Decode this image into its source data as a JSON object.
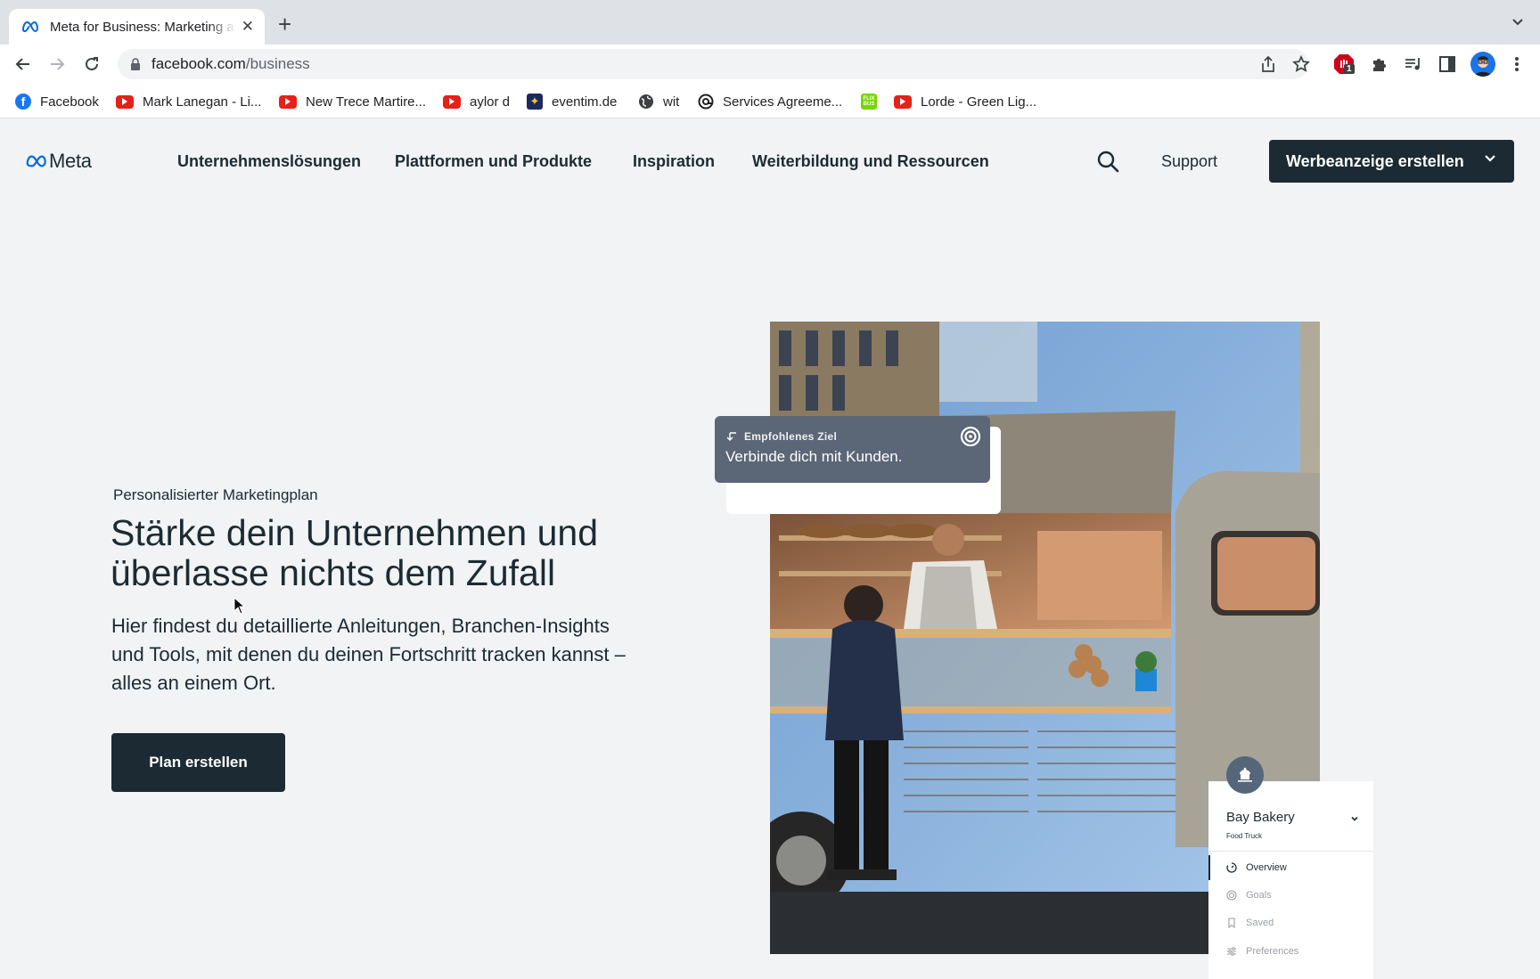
{
  "browser": {
    "tab": {
      "title": "Meta for Business: Marketing and Advertising",
      "favicon": "meta-logo-icon"
    },
    "new_tab_label": "+",
    "url": {
      "domain": "facebook.com",
      "path": "/business"
    },
    "extensions": {
      "adblock_badge": "1"
    },
    "bookmarks": [
      {
        "label": "Facebook",
        "icon": "facebook-icon"
      },
      {
        "label": "Mark Lanegan - Li...",
        "icon": "youtube-icon"
      },
      {
        "label": "New Trece Martire...",
        "icon": "youtube-icon"
      },
      {
        "label": "aylor d",
        "icon": "youtube-icon"
      },
      {
        "label": "eventim.de",
        "icon": "eventim-icon"
      },
      {
        "label": "wit",
        "icon": "globe-icon"
      },
      {
        "label": "Services Agreeme...",
        "icon": "at-sign-icon"
      },
      {
        "label": "",
        "icon": "flixbus-icon"
      },
      {
        "label": "Lorde - Green Lig...",
        "icon": "youtube-icon"
      }
    ]
  },
  "header": {
    "logo_text": "Meta",
    "nav": [
      "Unternehmenslösungen",
      "Plattformen und Produkte",
      "Inspiration",
      "Weiterbildung und Ressourcen"
    ],
    "support_label": "Support",
    "cta_label": "Werbeanzeige erstellen"
  },
  "hero": {
    "eyebrow": "Personalisierter Marketingplan",
    "headline": "Stärke dein Unternehmen und überlasse nichts dem Zufall",
    "body": "Hier findest du detaillierte Anleitungen, Branchen-Insights und Tools, mit denen du deinen Fortschritt tracken kannst – alles an einem Ort.",
    "button_label": "Plan erstellen"
  },
  "goal_card": {
    "label": "Empfohlenes Ziel",
    "value": "Verbinde dich mit Kunden."
  },
  "bakery_panel": {
    "name": "Bay Bakery",
    "subtitle": "Food Truck",
    "menu": [
      {
        "label": "Overview",
        "icon": "overview-icon",
        "active": true
      },
      {
        "label": "Goals",
        "icon": "target-icon",
        "active": false
      },
      {
        "label": "Saved",
        "icon": "bookmark-icon",
        "active": false
      },
      {
        "label": "Preferences",
        "icon": "sliders-icon",
        "active": false
      }
    ]
  },
  "colors": {
    "brand_dark": "#1c2b33",
    "meta_blue": "#0668e1",
    "page_bg": "#f1f3f4",
    "goal_card_bg": "#5b6676"
  }
}
